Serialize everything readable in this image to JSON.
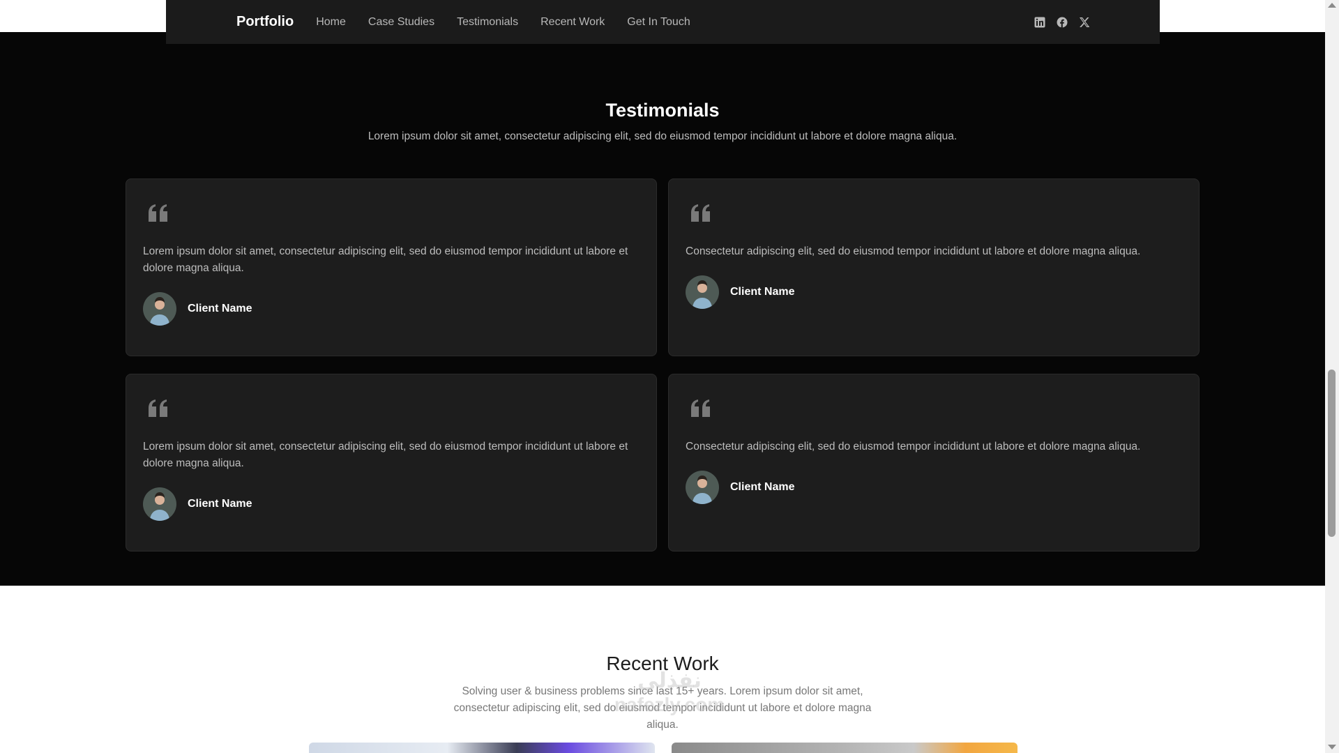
{
  "nav": {
    "brand": "Portfolio",
    "links": [
      "Home",
      "Case Studies",
      "Testimonials",
      "Recent Work",
      "Get In Touch"
    ],
    "social_icons": [
      "linkedin-icon",
      "facebook-icon",
      "x-icon"
    ]
  },
  "testimonials": {
    "title": "Testimonials",
    "subtitle": "Lorem ipsum dolor sit amet, consectetur adipiscing elit, sed do eiusmod tempor incididunt ut labore et dolore magna aliqua.",
    "cards": [
      {
        "text": "Lorem ipsum dolor sit amet, consectetur adipiscing elit, sed do eiusmod tempor incididunt ut labore et dolore magna aliqua.",
        "client": "Client Name"
      },
      {
        "text": "Consectetur adipiscing elit, sed do eiusmod tempor incididunt ut labore et dolore magna aliqua.",
        "client": "Client Name"
      },
      {
        "text": "Lorem ipsum dolor sit amet, consectetur adipiscing elit, sed do eiusmod tempor incididunt ut labore et dolore magna aliqua.",
        "client": "Client Name"
      },
      {
        "text": "Consectetur adipiscing elit, sed do eiusmod tempor incididunt ut labore et dolore magna aliqua.",
        "client": "Client Name"
      }
    ]
  },
  "recent_work": {
    "title": "Recent Work",
    "subtitle": "Solving user & business problems since last 15+ years. Lorem ipsum dolor sit amet, consectetur adipiscing elit, sed do eiusmod tempor incididunt ut labore et dolore magna aliqua."
  },
  "watermark": {
    "line1": "نفذلي",
    "line2": "nafezly.com"
  },
  "colors": {
    "dark_bg": "#060606",
    "card_bg": "#1d1d1d",
    "navbar_bg": "#1b1b1b",
    "accent_text": "#ffffff",
    "muted_text": "#bdbdbd"
  }
}
